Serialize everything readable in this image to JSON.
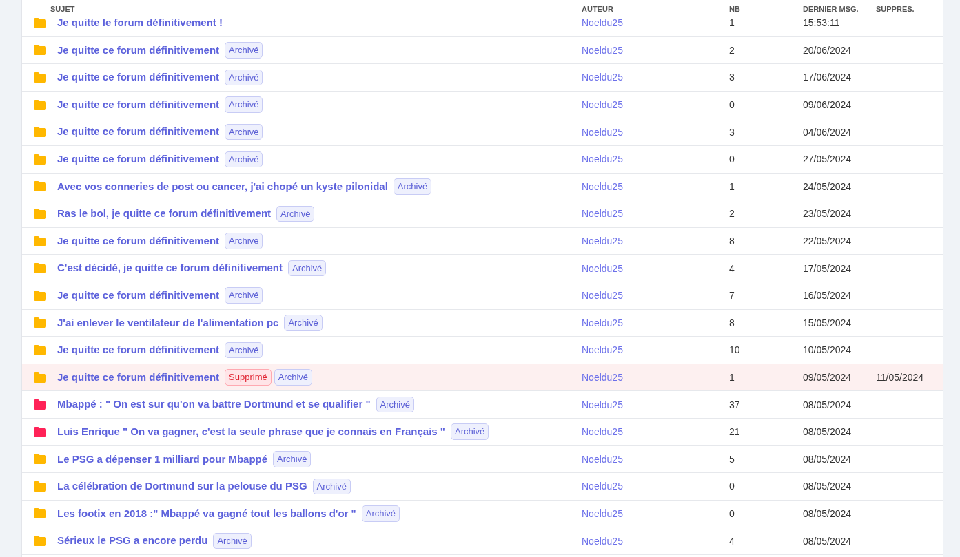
{
  "columns": [
    "SUJET",
    "AUTEUR",
    "NB",
    "DERNIER MSG.",
    "SUPPRES."
  ],
  "rows": [
    {
      "color": "#ffb800",
      "title": "Je quitte le forum définitivement !",
      "badges": [],
      "author": "Noeldu25",
      "count": "1",
      "last": "15:53:11",
      "deleted": false
    },
    {
      "color": "#ffb800",
      "title": "Je quitte ce forum définitivement",
      "badges": [
        {
          "kind": "archived",
          "label": "Archivé"
        }
      ],
      "author": "Noeldu25",
      "count": "2",
      "last": "20/06/2024",
      "deleted": false
    },
    {
      "color": "#ffb800",
      "title": "Je quitte ce forum définitivement",
      "badges": [
        {
          "kind": "archived",
          "label": "Archivé"
        }
      ],
      "author": "Noeldu25",
      "count": "3",
      "last": "17/06/2024",
      "deleted": false
    },
    {
      "color": "#ffb800",
      "title": "Je quitte ce forum définitivement",
      "badges": [
        {
          "kind": "archived",
          "label": "Archivé"
        }
      ],
      "author": "Noeldu25",
      "count": "0",
      "last": "09/06/2024",
      "deleted": false
    },
    {
      "color": "#ffb800",
      "title": "Je quitte ce forum définitivement",
      "badges": [
        {
          "kind": "archived",
          "label": "Archivé"
        }
      ],
      "author": "Noeldu25",
      "count": "3",
      "last": "04/06/2024",
      "deleted": false
    },
    {
      "color": "#ffb800",
      "title": "Je quitte ce forum définitivement",
      "badges": [
        {
          "kind": "archived",
          "label": "Archivé"
        }
      ],
      "author": "Noeldu25",
      "count": "0",
      "last": "27/05/2024",
      "deleted": false
    },
    {
      "color": "#ffb800",
      "title": "Avec vos conneries de post ou cancer, j'ai chopé un kyste pilonidal",
      "badges": [
        {
          "kind": "archived",
          "label": "Archivé"
        }
      ],
      "author": "Noeldu25",
      "count": "1",
      "last": "24/05/2024",
      "deleted": false
    },
    {
      "color": "#ffb800",
      "title": "Ras le bol, je quitte ce forum définitivement",
      "badges": [
        {
          "kind": "archived",
          "label": "Archivé"
        }
      ],
      "author": "Noeldu25",
      "count": "2",
      "last": "23/05/2024",
      "deleted": false
    },
    {
      "color": "#ffb800",
      "title": "Je quitte ce forum définitivement",
      "badges": [
        {
          "kind": "archived",
          "label": "Archivé"
        }
      ],
      "author": "Noeldu25",
      "count": "8",
      "last": "22/05/2024",
      "deleted": false
    },
    {
      "color": "#ffb800",
      "title": "C'est décidé, je quitte ce forum définitivement",
      "badges": [
        {
          "kind": "archived",
          "label": "Archivé"
        }
      ],
      "author": "Noeldu25",
      "count": "4",
      "last": "17/05/2024",
      "deleted": false
    },
    {
      "color": "#ffb800",
      "title": "Je quitte ce forum définitivement",
      "badges": [
        {
          "kind": "archived",
          "label": "Archivé"
        }
      ],
      "author": "Noeldu25",
      "count": "7",
      "last": "16/05/2024",
      "deleted": false
    },
    {
      "color": "#ffb800",
      "title": "J'ai enlever le ventilateur de l'alimentation pc",
      "badges": [
        {
          "kind": "archived",
          "label": "Archivé"
        }
      ],
      "author": "Noeldu25",
      "count": "8",
      "last": "15/05/2024",
      "deleted": false
    },
    {
      "color": "#ffb800",
      "title": "Je quitte ce forum définitivement",
      "badges": [
        {
          "kind": "archived",
          "label": "Archivé"
        }
      ],
      "author": "Noeldu25",
      "count": "10",
      "last": "10/05/2024",
      "deleted": false
    },
    {
      "color": "#ffb800",
      "title": "Je quitte ce forum définitivement",
      "badges": [
        {
          "kind": "deleted",
          "label": "Supprimé"
        },
        {
          "kind": "archived",
          "label": "Archivé"
        }
      ],
      "author": "Noeldu25",
      "count": "1",
      "last": "09/05/2024",
      "deleted": true,
      "deleted_on": "11/05/2024"
    },
    {
      "color": "#ff2257",
      "title": "Mbappé : \" On est sur qu'on va battre Dortmund et se qualifier \"",
      "badges": [
        {
          "kind": "archived",
          "label": "Archivé"
        }
      ],
      "author": "Noeldu25",
      "count": "37",
      "last": "08/05/2024",
      "deleted": false
    },
    {
      "color": "#ff2257",
      "title": "Luis Enrique \" On va gagner, c'est la seule phrase que je connais en Français \"",
      "badges": [
        {
          "kind": "archived",
          "label": "Archivé"
        }
      ],
      "author": "Noeldu25",
      "count": "21",
      "last": "08/05/2024",
      "deleted": false
    },
    {
      "color": "#ffb800",
      "title": "Le PSG a dépenser 1 milliard pour Mbappé",
      "badges": [
        {
          "kind": "archived",
          "label": "Archivé"
        }
      ],
      "author": "Noeldu25",
      "count": "5",
      "last": "08/05/2024",
      "deleted": false
    },
    {
      "color": "#ffb800",
      "title": "La célébration de Dortmund sur la pelouse du PSG",
      "badges": [
        {
          "kind": "archived",
          "label": "Archivé"
        }
      ],
      "author": "Noeldu25",
      "count": "0",
      "last": "08/05/2024",
      "deleted": false
    },
    {
      "color": "#ffb800",
      "title": "Les footix en 2018 :\" Mbappé va gagné tout les ballons d'or \"",
      "badges": [
        {
          "kind": "archived",
          "label": "Archivé"
        }
      ],
      "author": "Noeldu25",
      "count": "0",
      "last": "08/05/2024",
      "deleted": false
    },
    {
      "color": "#ffb800",
      "title": "Sérieux le PSG a encore perdu",
      "badges": [
        {
          "kind": "archived",
          "label": "Archivé"
        }
      ],
      "author": "Noeldu25",
      "count": "4",
      "last": "08/05/2024",
      "deleted": false
    }
  ]
}
